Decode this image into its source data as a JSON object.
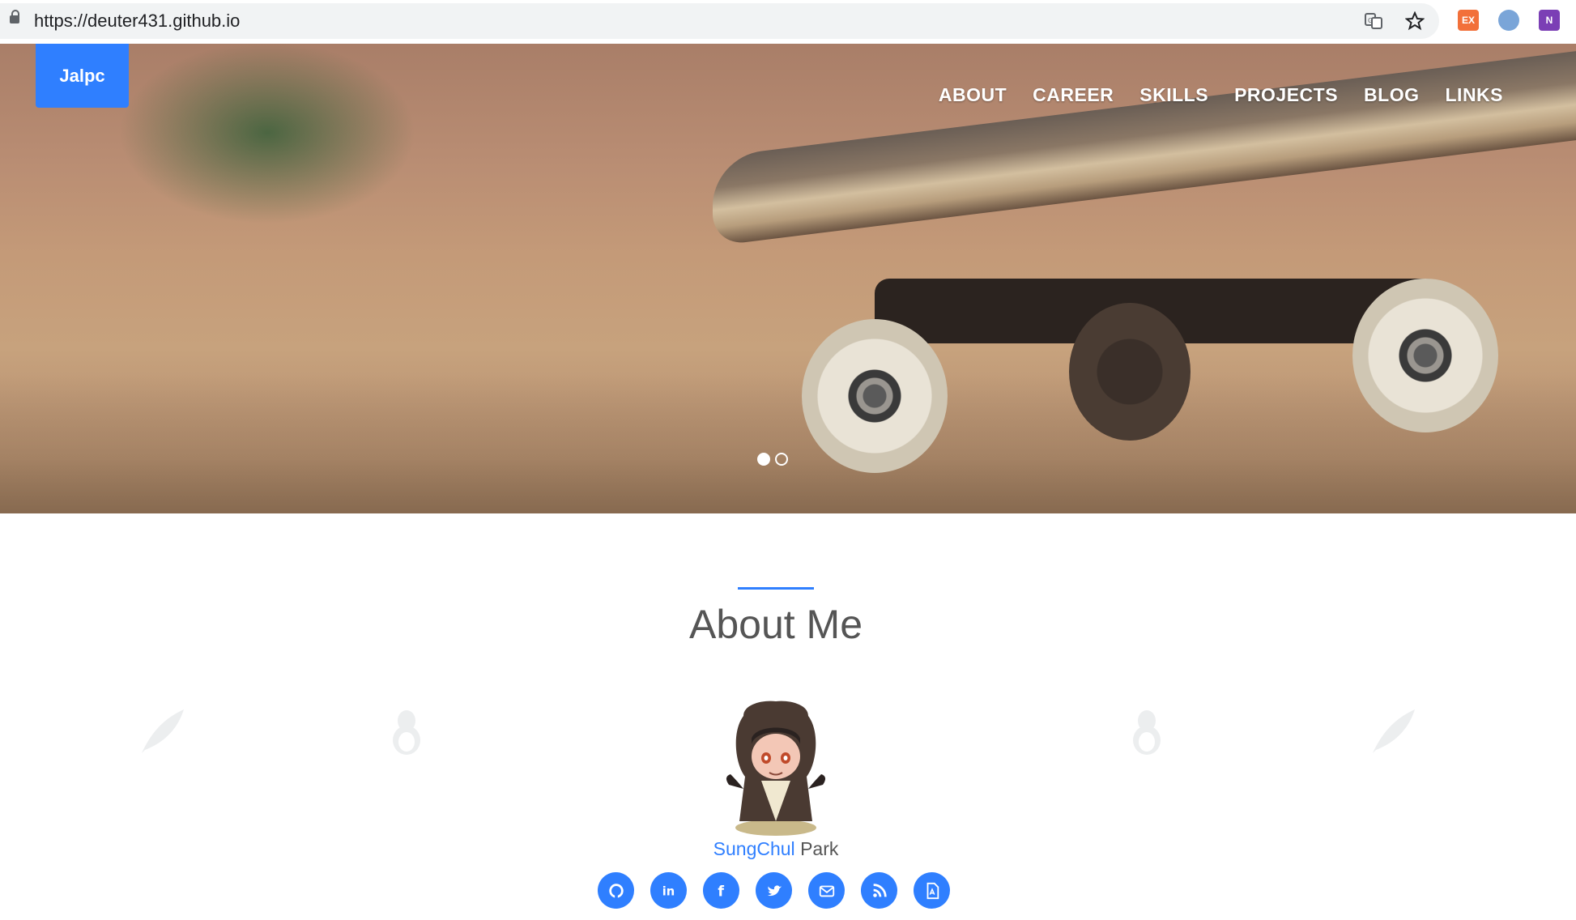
{
  "browser": {
    "url": "https://deuter431.github.io"
  },
  "header": {
    "brand": "Jalpc",
    "nav": [
      "ABOUT",
      "CAREER",
      "SKILLS",
      "PROJECTS",
      "BLOG",
      "LINKS"
    ]
  },
  "hero": {
    "slides": 2,
    "active_slide": 1
  },
  "about": {
    "title": "About Me",
    "first_name": "SungChul",
    "last_name": "Park",
    "social_icons": [
      "github-icon",
      "linkedin-icon",
      "facebook-icon",
      "twitter-icon",
      "email-icon",
      "rss-icon",
      "pdf-icon"
    ]
  },
  "colors": {
    "accent": "#2f7fff",
    "nav_text": "#ffffff",
    "title_text": "#555555"
  }
}
